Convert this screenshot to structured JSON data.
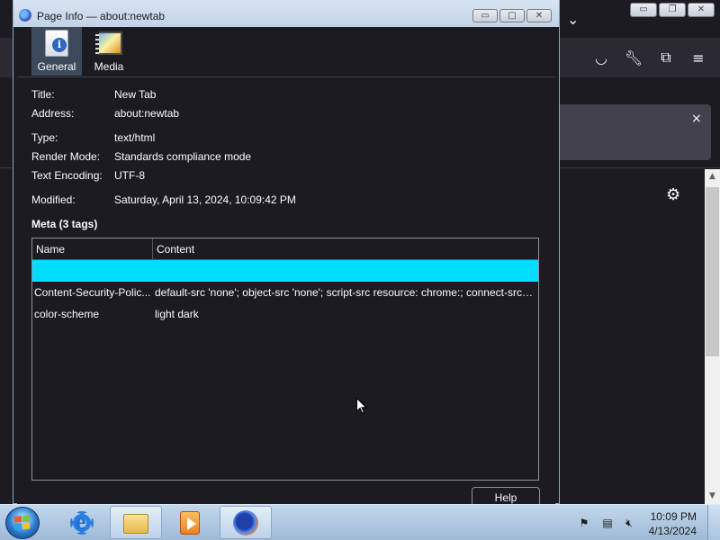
{
  "dialog": {
    "title": "Page Info — about:newtab",
    "tabs": [
      {
        "label": "General",
        "icon": "info-document-icon",
        "selected": true
      },
      {
        "label": "Media",
        "icon": "film-image-icon",
        "selected": false
      }
    ],
    "properties": {
      "title_label": "Title:",
      "title_value": "New Tab",
      "address_label": "Address:",
      "address_value": "about:newtab",
      "type_label": "Type:",
      "type_value": "text/html",
      "render_label": "Render Mode:",
      "render_value": "Standards compliance mode",
      "encoding_label": "Text Encoding:",
      "encoding_value": "UTF-8",
      "modified_label": "Modified:",
      "modified_value": "Saturday, April 13, 2024, 10:09:42 PM"
    },
    "meta_heading": "Meta (3 tags)",
    "meta_table": {
      "columns": [
        "Name",
        "Content"
      ],
      "rows": [
        {
          "name": "",
          "content": ""
        },
        {
          "name": "Content-Security-Polic...",
          "content": "default-src 'none'; object-src 'none'; script-src resource: chrome:; connect-src ..."
        },
        {
          "name": "color-scheme",
          "content": "light dark"
        }
      ],
      "selected_row_color": "#00ddff"
    },
    "help_label": "Help",
    "caption_buttons": [
      "minimize",
      "maximize",
      "close"
    ]
  },
  "background_window": {
    "toolbar_icons": [
      "pocket-icon",
      "wrench-icon",
      "extensions-icon",
      "menu-icon"
    ],
    "notice_close": "×",
    "settings_icon": "gear-icon"
  },
  "taskbar": {
    "pinned": [
      "internet-explorer-icon",
      "file-explorer-icon",
      "media-player-icon",
      "firefox-icon"
    ],
    "clock_time": "10:09 PM",
    "clock_date": "4/13/2024",
    "tray_icons": [
      "action-center-flag-icon",
      "network-icon",
      "volume-muted-icon"
    ]
  },
  "colors": {
    "dialog_bg": "#1c1b22",
    "text": "#fbfbfe",
    "selection": "#00ddff",
    "taskbar": "#b3cce5"
  }
}
